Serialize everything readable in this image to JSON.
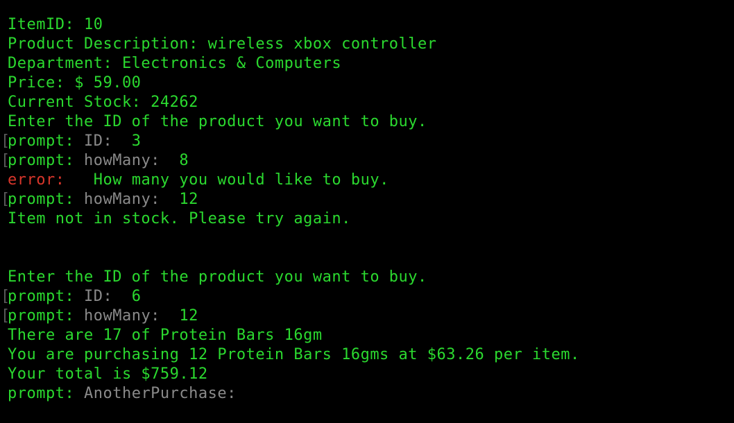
{
  "colors": {
    "background": "#000000",
    "text": "#2bd92f",
    "prompt_label": "#8a8a8a",
    "error": "#d9362b"
  },
  "lines": {
    "item_id": "ItemID: 10",
    "product_description": "Product Description: wireless xbox controller",
    "department": "Department: Electronics & Computers",
    "price": "Price: $ 59.00",
    "current_stock": "Current Stock: 24262",
    "enter_id_1": "Enter the ID of the product you want to buy.",
    "prompt_id_1": {
      "prefix": "prompt: ",
      "label": "ID:",
      "value": "  3"
    },
    "prompt_howmany_1": {
      "prefix": "prompt: ",
      "label": "howMany:",
      "value": "  8"
    },
    "error_line": {
      "prefix": "error:",
      "message": "   How many you would like to buy."
    },
    "prompt_howmany_2": {
      "prefix": "prompt: ",
      "label": "howMany:",
      "value": "  12"
    },
    "not_in_stock": "Item not in stock. Please try again.",
    "enter_id_2": "Enter the ID of the product you want to buy.",
    "prompt_id_2": {
      "prefix": "prompt: ",
      "label": "ID:",
      "value": "  6"
    },
    "prompt_howmany_3": {
      "prefix": "prompt: ",
      "label": "howMany:",
      "value": "  12"
    },
    "there_are": "There are 17 of Protein Bars 16gm",
    "purchasing": "You are purchasing 12 Protein Bars 16gms at $63.26 per item.",
    "total": "Your total is $759.12",
    "prompt_another": {
      "prefix": "prompt: ",
      "label": "AnotherPurchase:"
    }
  },
  "bracket_glyph": "["
}
